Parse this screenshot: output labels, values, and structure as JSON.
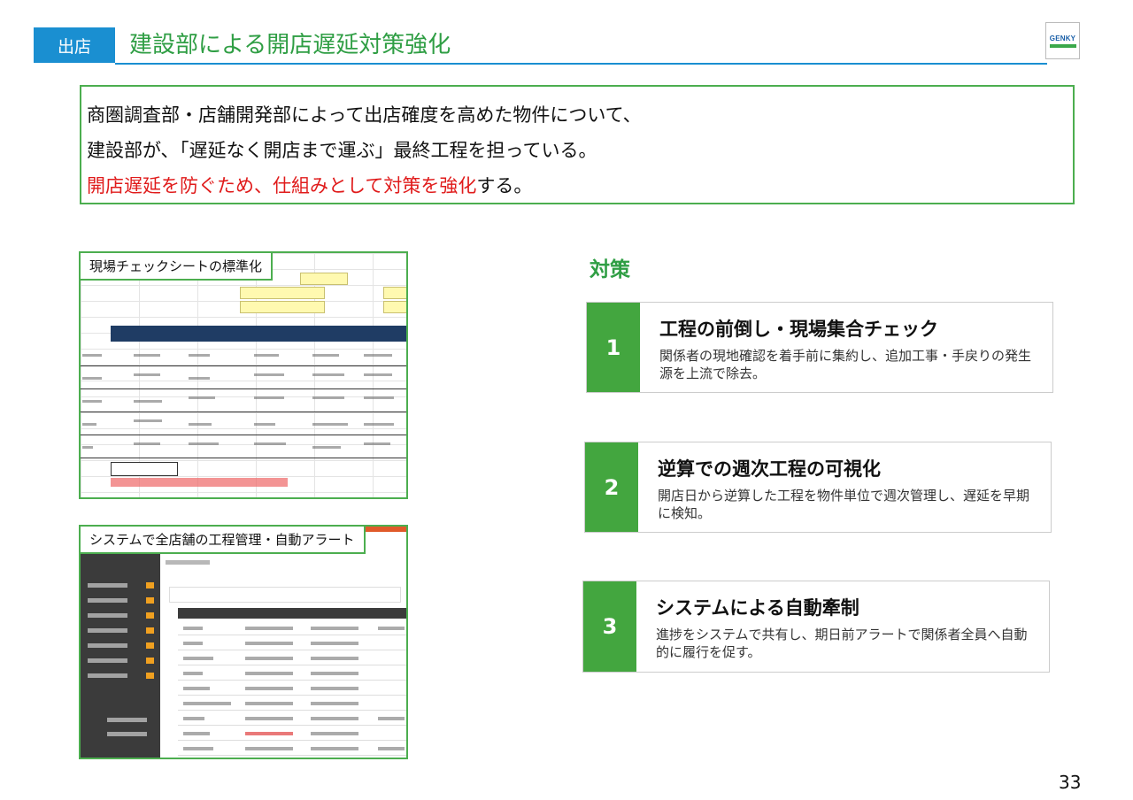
{
  "header": {
    "section_tag": "出店",
    "title": "建設部による開店遅延対策強化",
    "logo_text": "GENKY"
  },
  "intro": {
    "line1": "商圏調査部・店舗開発部によって出店確度を高めた物件について、",
    "line2": "建設部が､「遅延なく開店まで運ぶ」最終工程を担っている。",
    "line3_highlight": "開店遅延を防ぐため、仕組みとして対策を強化",
    "line3_tail": "する。"
  },
  "screenshots": {
    "sheet_label": "現場チェックシートの標準化",
    "system_label": "システムで全店舗の工程管理・自動アラート"
  },
  "measures": {
    "title": "対策",
    "items": [
      {
        "num": "1",
        "title": "工程の前倒し・現場集合チェック",
        "desc": "関係者の現地確認を着手前に集約し、追加工事・手戻りの発生源を上流で除去。"
      },
      {
        "num": "2",
        "title": "逆算での週次工程の可視化",
        "desc": "開店日から逆算した工程を物件単位で週次管理し、遅延を早期に検知。"
      },
      {
        "num": "3",
        "title": "システムによる自動牽制",
        "desc": "進捗をシステムで共有し、期日前アラートで関係者全員へ自動的に履行を促す。"
      }
    ]
  },
  "colors": {
    "accent_blue": "#1a8fd1",
    "accent_green": "#43a63f",
    "highlight_red": "#e01b1b"
  },
  "page_number": "33"
}
